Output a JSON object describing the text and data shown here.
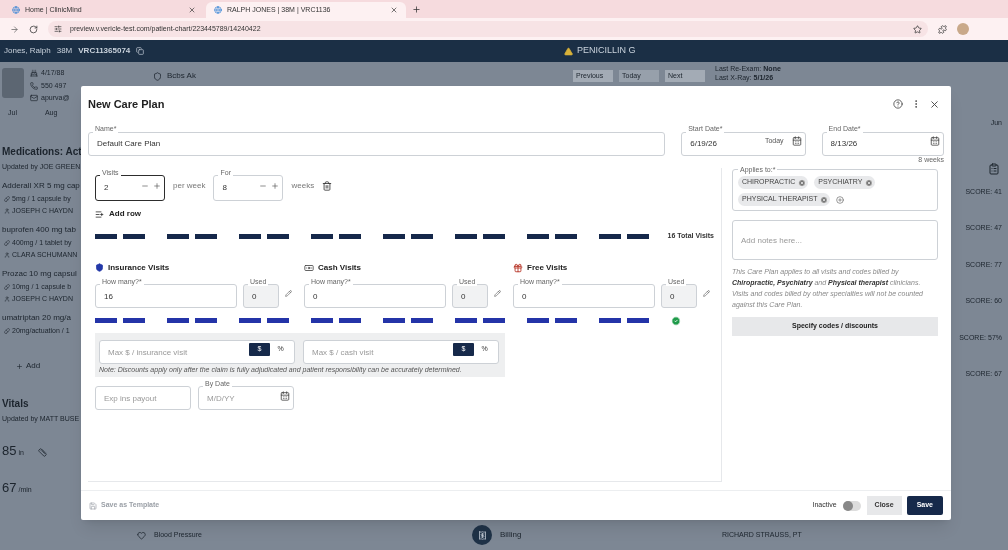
{
  "browser": {
    "tabs": [
      {
        "title": "Home | ClinicMind",
        "selected": false
      },
      {
        "title": "RALPH JONES | 38M | VRC1136",
        "selected": true
      }
    ],
    "url": "preview.v.vericle-test.com/patient-chart/223445789/14240422"
  },
  "patient_bar": {
    "name": "Jones, Ralph",
    "age_sex": "38M",
    "chart_id": "VRC11365074",
    "allergy": "PENICILLIN G"
  },
  "patient_info": {
    "dob": "4/17/88",
    "phone": "550 497",
    "email": "apurva@",
    "insurance": "Bcbs Ak",
    "nav": [
      {
        "label": "Previous",
        "selected": false
      },
      {
        "label": "Today",
        "selected": true
      },
      {
        "label": "Next",
        "selected": false
      }
    ],
    "last_reexam_label": "Last Re-Exam:",
    "last_reexam": "None",
    "last_xray_label": "Last X-Ray:",
    "last_xray": "5/1/26"
  },
  "timeline": {
    "left": [
      "Jul",
      "Aug"
    ],
    "right": "Jun"
  },
  "medications": {
    "title": "Medications: Act",
    "updated": "Updated by JOE GREEN",
    "items": [
      {
        "name": "Adderall XR 5 mg cap",
        "dose": "5mg / 1 capsule by",
        "prescriber": "JOSEPH C HAYDN"
      },
      {
        "name": "buprofen 400 mg tab",
        "dose": "400mg / 1 tablet by",
        "prescriber": "CLARA SCHUMANN"
      },
      {
        "name": "Prozac 10 mg capsul",
        "dose": "10mg / 1 capsule b",
        "prescriber": "JOSEPH C HAYDN"
      },
      {
        "name": "umatriptan 20 mg/a",
        "dose": "20mg/actuation / 1"
      }
    ],
    "add": "Add"
  },
  "vitals": {
    "title": "Vitals",
    "updated": "Updated by MATT BUSE",
    "height": {
      "value": "85",
      "unit": "in"
    },
    "heart_rate": {
      "value": "67",
      "unit": "/min"
    },
    "blood_pressure_label": "Blood Pressure"
  },
  "scores": [
    "SCORE: 41",
    "SCORE: 47",
    "SCORE: 77",
    "SCORE: 60",
    "SCORE: 57%",
    "SCORE: 67"
  ],
  "billing": "Billing",
  "provider": "RICHARD STRAUSS, PT",
  "care_plan": {
    "title": "New Care Plan",
    "name": {
      "label": "Name*",
      "value": "Default Care Plan"
    },
    "start_date": {
      "label": "Start Date*",
      "value": "6/19/26",
      "today": "Today"
    },
    "end_date": {
      "label": "End Date*",
      "value": "8/13/26"
    },
    "duration": "8 weeks",
    "schedule_rows": [
      {
        "visits": {
          "label": "Visits",
          "value": "2",
          "focused": true
        },
        "per": "per week",
        "for": {
          "label": "For",
          "value": "8",
          "focused": false
        },
        "unit": "weeks"
      }
    ],
    "add_row": "Add row",
    "total_visits": "16 Total Visits",
    "visit_types": [
      {
        "kind": "insurance",
        "title": "Insurance Visits",
        "how_many_label": "How many?*",
        "how_many": "16",
        "used_label": "Used",
        "used": "0"
      },
      {
        "kind": "cash",
        "title": "Cash Visits",
        "how_many_label": "How many?*",
        "how_many": "0",
        "used_label": "Used",
        "used": "0"
      },
      {
        "kind": "free",
        "title": "Free Visits",
        "how_many_label": "How many?*",
        "how_many": "0",
        "used_label": "Used",
        "used": "0"
      }
    ],
    "discounts": [
      {
        "placeholder": "Max $ / insurance visit",
        "modes": [
          {
            "label": "$",
            "selected": true
          },
          {
            "label": "%",
            "selected": false
          }
        ]
      },
      {
        "placeholder": "Max $ / cash visit",
        "modes": [
          {
            "label": "$",
            "selected": true
          },
          {
            "label": "%",
            "selected": false
          }
        ]
      }
    ],
    "note": "Note: Discounts apply only after the claim is fully adjudicated and patient responsibility can be accurately determined.",
    "exp_payout": {
      "placeholder": "Exp ins payout"
    },
    "by_date": {
      "label": "By Date",
      "placeholder": "M/D/YY"
    },
    "applies_to": {
      "label": "Applies to:*",
      "chips": [
        "CHIROPRACTIC",
        "PSYCHIATRY",
        "PHYSICAL THERAPIST"
      ]
    },
    "notes": {
      "placeholder": "Add notes here..."
    },
    "info": "This Care Plan applies to all visits and codes billed by **Chiropractic, Psychiatry** and **Physical therapist** clinicians. Visits and codes billed by other specialties will not be counted against this Care Plan.",
    "specify_button": "Specify codes / discounts",
    "save_template": {
      "label": "Save as Template",
      "disabled": true
    },
    "inactive": {
      "label": "Inactive",
      "on": false
    },
    "close": "Close",
    "save": "Save"
  }
}
